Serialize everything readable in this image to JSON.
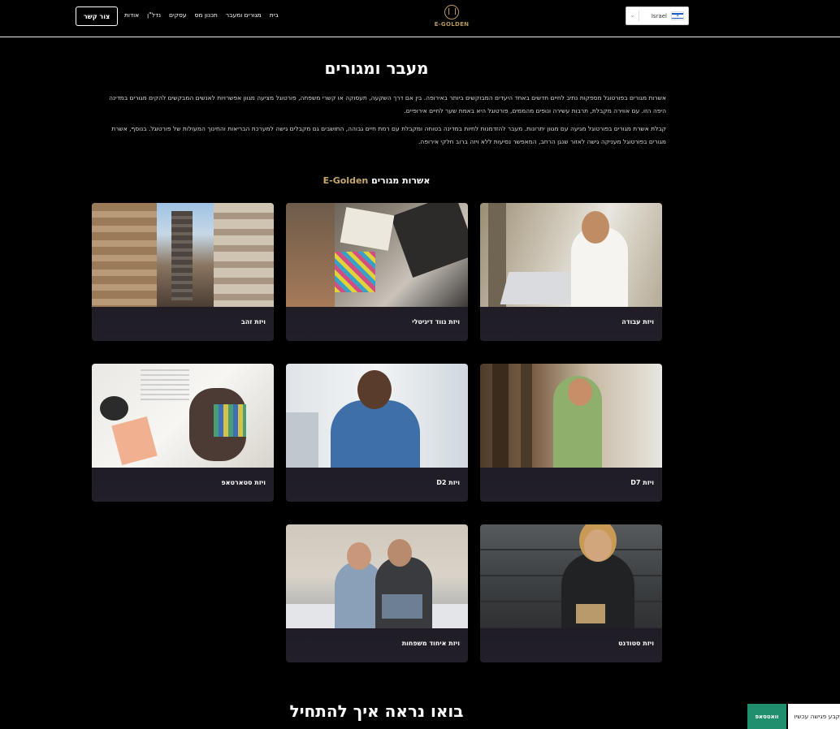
{
  "header": {
    "contact_label": "צור קשר",
    "nav": [
      "אודות",
      "נדל\"ן",
      "עסקים",
      "תכנון מס",
      "מגורים ומעבר",
      "בית"
    ],
    "logo_text": "E-GOLDEN",
    "language": {
      "selected": "Israel",
      "flag": "israel-flag-icon"
    }
  },
  "main": {
    "title": "מעבר ומגורים",
    "intro": [
      "אשרות מגורים בפורטוגל מספקות נתיב לחיים חדשים באחד היעדים המבוקשים ביותר באירופה. בין אם דרך השקעה, תעסוקה או קשרי משפחה, פורטוגל מציעה מגוון אפשרויות לאנשים המבקשים להקים מגורים במדינה היפה הזו. עם אווירה מקבלת, תרבות עשירה ונופים מהממים, פורטוגל היא באמת שער לחיים אירופיים.",
      "קבלת אשרת מגורים בפורטוגל מגיעה עם מגוון יתרונות. מעבר להזדמנות לחיות במדינה בטוחה ומקבלת עם רמת חיים גבוהה, התושבים גם מקבלים גישה למערכת הבריאות והחינוך המעולות של פורטוגל. בנוסף, אשרת מגורים בפורטוגל מעניקה גישה לאזור שנגן הרחב, המאפשר נסיעות ללא ויזה ברוב חלקי אירופה."
    ],
    "section_brand": "E-Golden",
    "section_title": "אשרות מגורים",
    "cards": [
      {
        "label": "ויזת עבודה"
      },
      {
        "label": "ויזת נווד דיגיטלי"
      },
      {
        "label": "ויזת זהב"
      },
      {
        "label": "ויזת D7"
      },
      {
        "label": "ויזת D2"
      },
      {
        "label": "ויזת סטארטאפ"
      },
      {
        "label": "ויזת סטודנט"
      },
      {
        "label": "ויזת איחוד משפחות"
      }
    ],
    "bottom_heading": "בואו נראה איך להתחיל"
  },
  "floating": {
    "whatsapp_label": "וואטסאפ",
    "meeting_label": "קבע פגישה עכשיו"
  },
  "colors": {
    "background": "#000000",
    "brand_gold": "#c6a86a",
    "card_bg": "#1c1a22",
    "whatsapp_green": "#1f8f6e"
  }
}
